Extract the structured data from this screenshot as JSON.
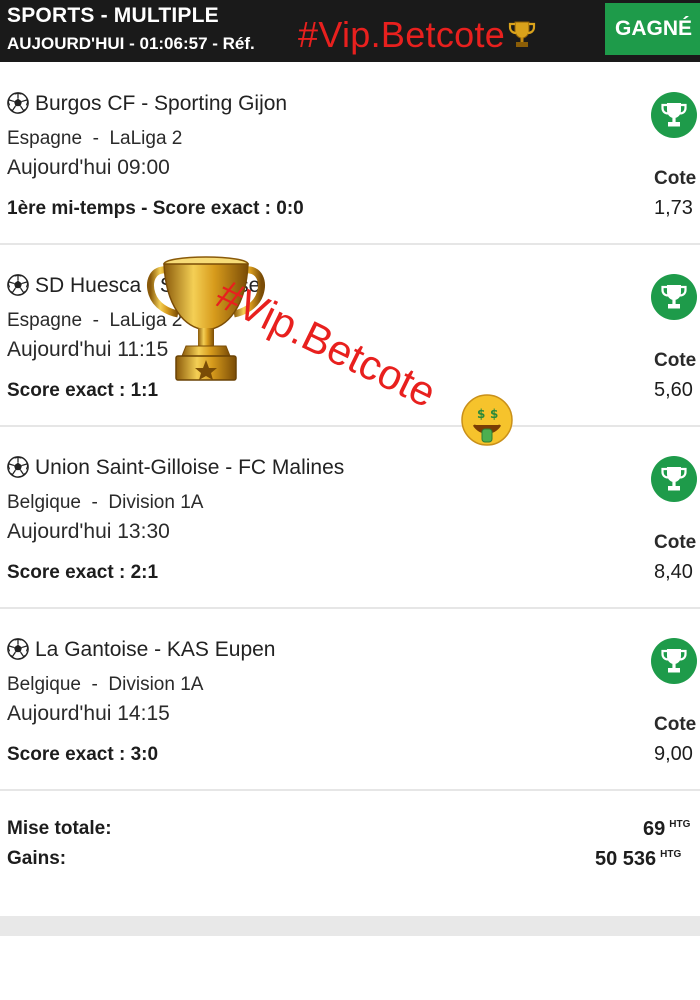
{
  "header": {
    "title": "SPORTS - MULTIPLE",
    "subtitle": "AUJOURD'HUI - 01:06:57 - Réf.",
    "watermark": "#Vip.Betcote",
    "status": "GAGNÉ"
  },
  "bets": [
    {
      "match": "Burgos CF - Sporting Gijon",
      "country": "Espagne",
      "league": "LaLiga 2",
      "time": "Aujourd'hui 09:00",
      "pick": "1ère mi-temps - Score exact : 0:0",
      "cote_label": "Cote",
      "cote": "1,73"
    },
    {
      "match": "SD Huesca - Saragosse",
      "country": "Espagne",
      "league": "LaLiga 2",
      "time": "Aujourd'hui 11:15",
      "pick": "Score exact : 1:1",
      "cote_label": "Cote",
      "cote": "5,60"
    },
    {
      "match": "Union Saint-Gilloise - FC Malines",
      "country": "Belgique",
      "league": "Division 1A",
      "time": "Aujourd'hui 13:30",
      "pick": "Score exact : 2:1",
      "cote_label": "Cote",
      "cote": "8,40"
    },
    {
      "match": "La Gantoise - KAS Eupen",
      "country": "Belgique",
      "league": "Division 1A",
      "time": "Aujourd'hui 14:15",
      "pick": "Score exact : 3:0",
      "cote_label": "Cote",
      "cote": "9,00"
    }
  ],
  "totals": {
    "stake_label": "Mise totale:",
    "stake_value": "69",
    "winnings_label": "Gains:",
    "winnings_value": "50 536",
    "currency": "HTG"
  },
  "overlay": {
    "watermark": "#Vip.Betcote"
  },
  "icons": {
    "ball": "soccer-ball-icon",
    "won": "trophy-icon",
    "overlay": "gold-trophy-icon",
    "emoji": "money-face-emoji"
  },
  "colors": {
    "header_bg": "#1a1a1a",
    "won_green": "#1e9b4a",
    "watermark_red": "#e8201e"
  }
}
